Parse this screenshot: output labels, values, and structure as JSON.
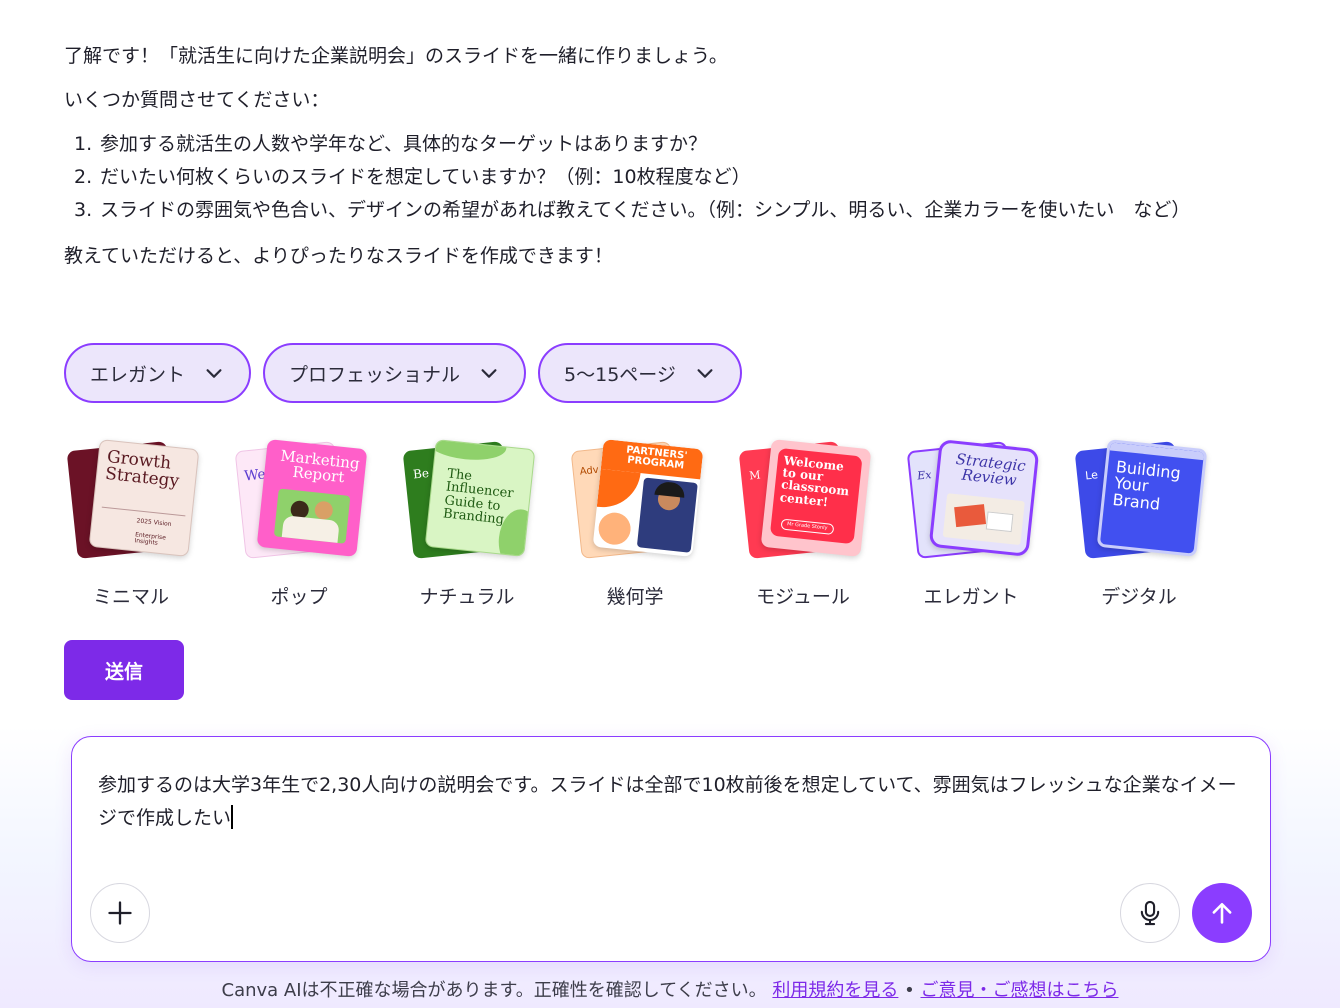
{
  "message": {
    "intro": "了解です！「就活生に向けた企業説明会」のスライドを一緒に作りましょう。",
    "question_lead": "いくつか質問させてください：",
    "questions": [
      {
        "num": "1.",
        "text": "参加する就活生の人数や学年など、具体的なターゲットはありますか？"
      },
      {
        "num": "2.",
        "text": "だいたい何枚くらいのスライドを想定していますか？（例：10枚程度など）"
      },
      {
        "num": "3.",
        "text": "スライドの雰囲気や色合い、デザインの希望があれば教えてください。（例：シンプル、明るい、企業カラーを使いたい　など）"
      }
    ],
    "closing": "教えていただけると、よりぴったりなスライドを作成できます！"
  },
  "chips": [
    {
      "label": "エレガント",
      "icon": "chevron-down-icon"
    },
    {
      "label": "プロフェッショナル",
      "icon": "chevron-down-icon"
    },
    {
      "label": "5〜15ページ",
      "icon": "chevron-down-icon"
    }
  ],
  "styles": [
    {
      "label": "ミニマル",
      "card_text": "Growth Strategy",
      "sub1": "2025 Vision",
      "sub2": "Enterprise Insights"
    },
    {
      "label": "ポップ",
      "card_text": "Marketing Report",
      "back_text": "We"
    },
    {
      "label": "ナチュラル",
      "card_text": "The Influencer Guide to Branding",
      "back_text": "Be"
    },
    {
      "label": "幾何学",
      "card_text": "PARTNERS' PROGRAM",
      "back_text": "Adv"
    },
    {
      "label": "モジュール",
      "card_text": "Welcome to our classroom center!",
      "sub1": "Mr Grade Stonly",
      "back_text": "M"
    },
    {
      "label": "エレガント",
      "card_text": "Strategic Review",
      "back_text": "Ex"
    },
    {
      "label": "デジタル",
      "card_text": "Building Your Brand",
      "back_text": "Le"
    }
  ],
  "send_button": "送信",
  "composer": {
    "text": "参加するのは大学3年生で2,30人向けの説明会です。スライドは全部で10枚前後を想定していて、雰囲気はフレッシュな企業なイメージで作成したい"
  },
  "footer": {
    "notice": "Canva AIは不正確な場合があります。正確性を確認してください。",
    "terms_link": "利用規約を見る",
    "separator": "•",
    "feedback_link": "ご意見・ご感想はこちら"
  },
  "colors": {
    "accent": "#8b3dff",
    "button": "#7d2ae8",
    "chip_bg": "#ece6fb"
  }
}
